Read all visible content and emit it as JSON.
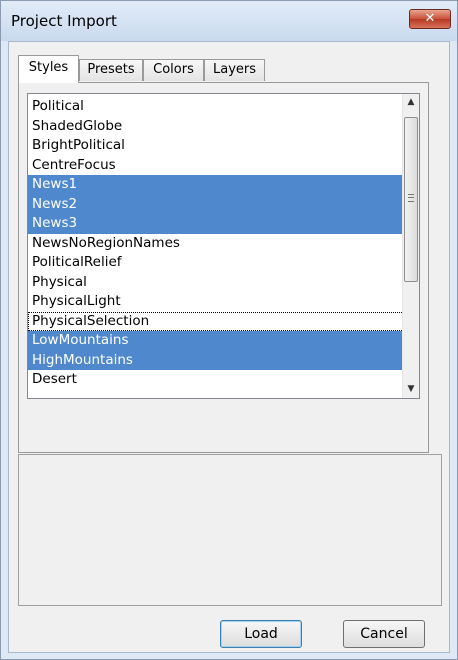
{
  "window": {
    "title": "Project Import",
    "close_glyph": "✕"
  },
  "tabs": [
    {
      "label": "Styles",
      "active": true
    },
    {
      "label": "Presets",
      "active": false
    },
    {
      "label": "Colors",
      "active": false
    },
    {
      "label": "Layers",
      "active": false
    }
  ],
  "styles_list": {
    "items": [
      {
        "label": "Political",
        "selected": false
      },
      {
        "label": "ShadedGlobe",
        "selected": false
      },
      {
        "label": "BrightPolitical",
        "selected": false
      },
      {
        "label": "CentreFocus",
        "selected": false
      },
      {
        "label": "News1",
        "selected": true
      },
      {
        "label": "News2",
        "selected": true
      },
      {
        "label": "News3",
        "selected": true
      },
      {
        "label": "NewsNoRegionNames",
        "selected": false
      },
      {
        "label": "PoliticalRelief",
        "selected": false
      },
      {
        "label": "Physical",
        "selected": false
      },
      {
        "label": "PhysicalLight",
        "selected": false
      },
      {
        "label": "PhysicalSelection",
        "selected": false,
        "focused": true
      },
      {
        "label": "LowMountains",
        "selected": true
      },
      {
        "label": "HighMountains",
        "selected": true
      },
      {
        "label": "Desert",
        "selected": false
      }
    ],
    "scroll_up_glyph": "▲",
    "scroll_down_glyph": "▼"
  },
  "buttons": {
    "load_label": "Load",
    "cancel_label": "Cancel"
  },
  "colors": {
    "selection": "#4f88cc",
    "close_button": "#c9503a"
  }
}
